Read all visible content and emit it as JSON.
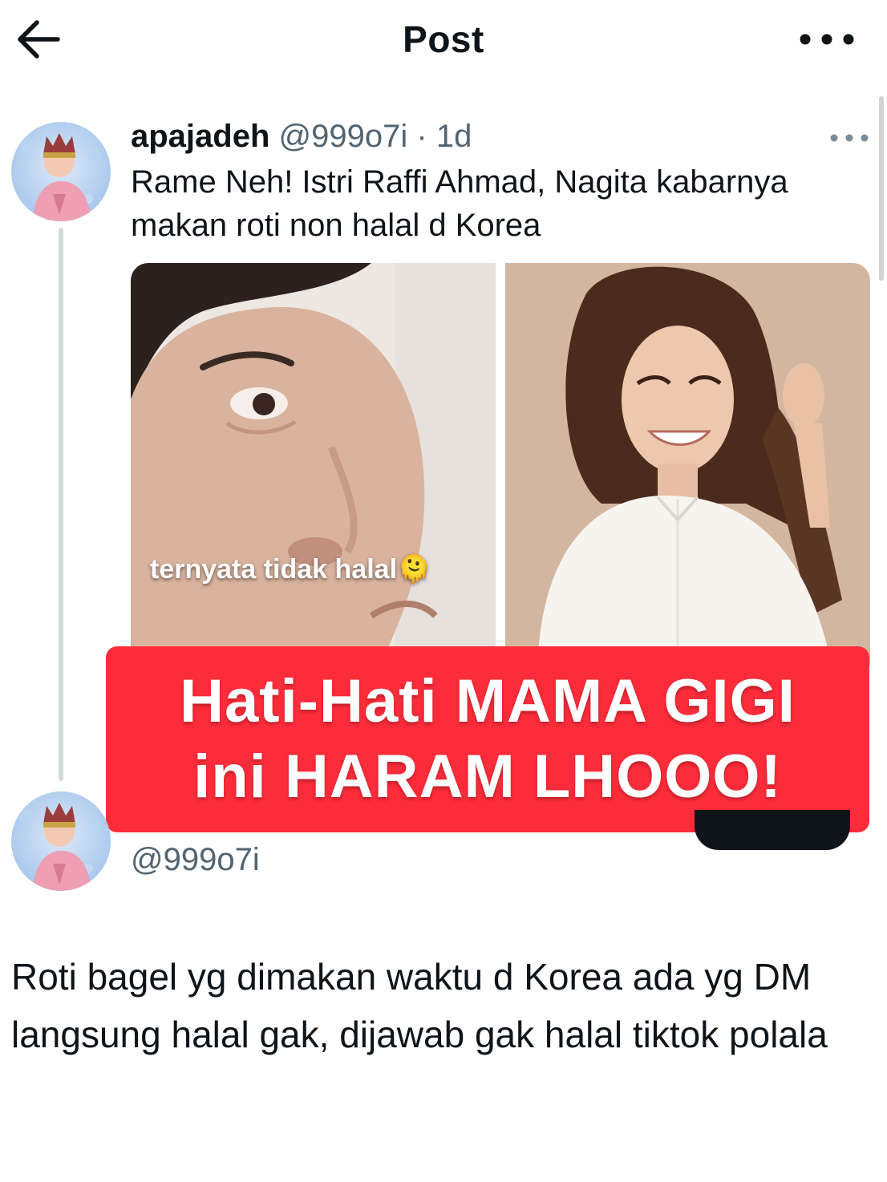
{
  "header": {
    "title": "Post",
    "back_icon": "arrow-left-icon",
    "more_icon": "more-horizontal-icon"
  },
  "quoted_post": {
    "name": "apajadeh",
    "handle": "@999o7i",
    "separator": "·",
    "time": "1d",
    "text": "Rame Neh! Istri Raffi Ahmad, Nagita kabarnya makan roti non halal d Korea",
    "media_caption": "ternyata tidak halal🫠"
  },
  "overlay": {
    "line1": "Hati-Hati MAMA GIGI",
    "line2": "ini HARAM LHOOO!",
    "color": "#fd2c3a"
  },
  "reply_author": {
    "handle": "@999o7i"
  },
  "main_post": {
    "text": "Roti bagel yg dimakan waktu d Korea ada yg DM langsung halal gak, dijawab gak halal tiktok polala"
  }
}
